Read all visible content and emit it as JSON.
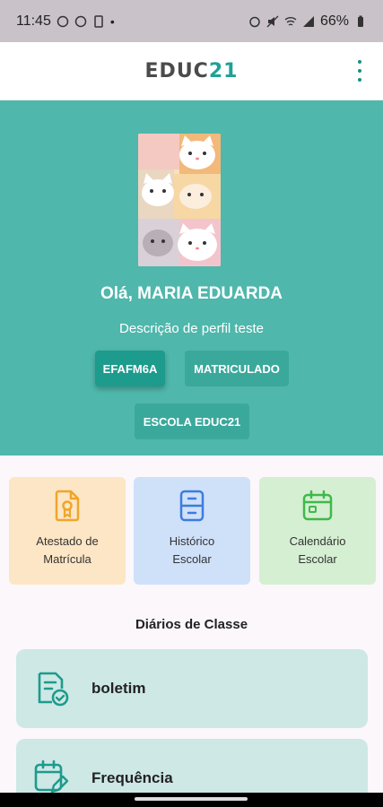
{
  "status_bar": {
    "time": "11:45",
    "battery": "66%"
  },
  "app": {
    "logo_prefix": "EDUC",
    "logo_suffix": "21",
    "accent_color": "#1fa196"
  },
  "profile": {
    "greeting": "Olá, MARIA EDUARDA",
    "description": "Descrição de perfil teste",
    "chips": [
      "EFAFM6A",
      "MATRICULADO",
      "ESCOLA EDUC21"
    ]
  },
  "shortcuts": [
    {
      "line1": "Atestado de",
      "line2": "Matrícula",
      "icon": "certificate-icon",
      "bg": "#fce6c5",
      "color": "#f0a52a"
    },
    {
      "line1": "Histórico",
      "line2": "Escolar",
      "icon": "archive-icon",
      "bg": "#cfe0f9",
      "color": "#3b7de0"
    },
    {
      "line1": "Calendário",
      "line2": "Escolar",
      "icon": "calendar-icon",
      "bg": "#d5efd2",
      "color": "#3fb94b"
    }
  ],
  "diarios": {
    "title": "Diários de Classe",
    "items": [
      {
        "label": "boletim",
        "icon": "report-check-icon"
      },
      {
        "label": "Frequência",
        "icon": "calendar-edit-icon"
      }
    ]
  }
}
